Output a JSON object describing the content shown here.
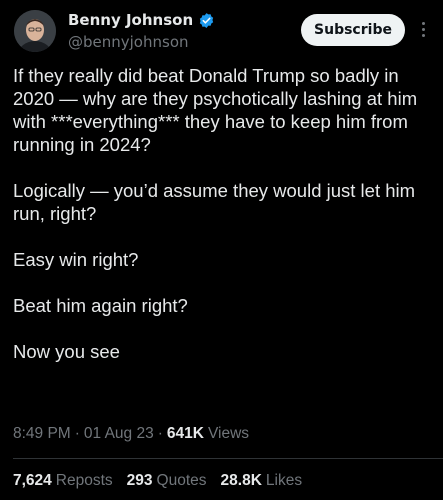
{
  "author": {
    "display_name": "Benny Johnson",
    "handle": "@bennyjohnson",
    "verified_icon": "verified-badge-icon",
    "verified_color": "#1d9bf0"
  },
  "actions": {
    "subscribe_label": "Subscribe",
    "more_icon": "more-vertical-icon"
  },
  "tweet": {
    "paragraphs": [
      "If they really did beat Donald Trump so badly in 2020 — why are they psychotically lashing at him with ***everything*** they have to keep him from running in 2024?",
      "Logically — you’d assume they would just let him run, right?",
      "Easy win right?",
      "Beat him again right?",
      "Now you see"
    ]
  },
  "meta": {
    "time": "8:49 PM",
    "separator": "·",
    "date": "01 Aug 23",
    "views_count": "641K",
    "views_label": "Views"
  },
  "stats": {
    "reposts_count": "7,624",
    "reposts_label": "Reposts",
    "quotes_count": "293",
    "quotes_label": "Quotes",
    "likes_count": "28.8K",
    "likes_label": "Likes"
  },
  "colors": {
    "background": "#000000",
    "text_primary": "#e7e9ea",
    "text_secondary": "#71767b",
    "button_bg": "#eff3f4"
  }
}
